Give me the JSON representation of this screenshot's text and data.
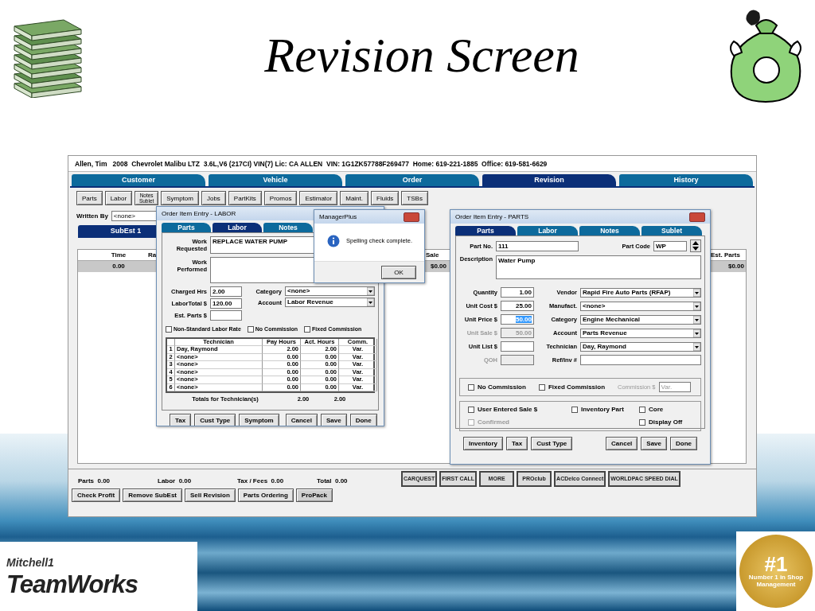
{
  "slide": {
    "title": "Revision Screen",
    "logo": {
      "brand": "Mitchell1",
      "product": "TeamWorks"
    },
    "badge": {
      "mark": "#1",
      "caption": "Number 1 in Shop Management"
    }
  },
  "app": {
    "header": "Allen, Tim   2008  Chevrolet Malibu LTZ  3.6L,V6 (217CI) VIN(7) Lic: CA ALLEN  VIN: 1G1ZK57788F269477  Home: 619-221-1885  Office: 619-581-6629",
    "tabs": [
      {
        "label": "Customer",
        "selected": false
      },
      {
        "label": "Vehicle",
        "selected": false
      },
      {
        "label": "Order",
        "selected": false
      },
      {
        "label": "Revision",
        "selected": true
      },
      {
        "label": "History",
        "selected": false
      }
    ],
    "toolbar": [
      "Parts",
      "Labor",
      "Notes Sublet",
      "Symptom",
      "Jobs",
      "PartKits",
      "Promos",
      "Estimator",
      "Maint.",
      "Fluids",
      "TSBs"
    ],
    "written_by": {
      "label": "Written By",
      "value": "<none>"
    },
    "subest_tabs": [
      {
        "label": "SubEst 1",
        "selected": true
      }
    ],
    "table": {
      "columns": [
        "Time",
        "Ra",
        "Sale",
        "Est. Parts"
      ],
      "rows": [
        {
          "time": "0.00",
          "sale": "$0.00",
          "est_parts": "$0.00"
        }
      ]
    },
    "totals": [
      {
        "label": "Parts",
        "value": "0.00"
      },
      {
        "label": "Labor",
        "value": "0.00"
      },
      {
        "label": "Tax / Fees",
        "value": "0.00"
      },
      {
        "label": "Total",
        "value": "0.00"
      }
    ],
    "vendor_logos": [
      "CARQUEST",
      "FIRST CALL",
      "MORE",
      "PROclub",
      "ACDelco Connect",
      "WORLDPAC SPEED DIAL"
    ],
    "buttons": [
      "Check Profit",
      "Remove SubEst",
      "Sell Revision",
      "Parts Ordering",
      "ProPack"
    ]
  },
  "labor_dialog": {
    "title": "Order Item Entry - LABOR",
    "tabs": [
      {
        "label": "Parts",
        "selected": false
      },
      {
        "label": "Labor",
        "selected": true
      },
      {
        "label": "Notes",
        "selected": false
      }
    ],
    "work_requested": {
      "label": "Work Requested",
      "value": "REPLACE WATER PUMP"
    },
    "work_performed": {
      "label": "Work Performed"
    },
    "left_fields": [
      {
        "label": "Charged Hrs",
        "value": "2.00"
      },
      {
        "label": "LaborTotal $",
        "value": "120.00"
      },
      {
        "label": "Est. Parts $"
      }
    ],
    "right_fields": [
      {
        "label": "Category",
        "value": "<none>"
      },
      {
        "label": "Account",
        "value": "Labor Revenue"
      }
    ],
    "checkboxes": [
      {
        "label": "Non-Standard Labor Rate",
        "checked": false
      },
      {
        "label": "No Commission",
        "checked": false
      },
      {
        "label": "Fixed Commission",
        "checked": false
      }
    ],
    "tech_columns": [
      "Technician",
      "Pay Hours",
      "Act. Hours",
      "Comm."
    ],
    "tech_rows": [
      {
        "num": "1",
        "tech": "Day, Raymond",
        "pay": "2.00",
        "act": "2.00",
        "comm": "Var."
      },
      {
        "num": "2",
        "tech": "<none>",
        "pay": "0.00",
        "act": "0.00",
        "comm": "Var."
      },
      {
        "num": "3",
        "tech": "<none>",
        "pay": "0.00",
        "act": "0.00",
        "comm": "Var."
      },
      {
        "num": "4",
        "tech": "<none>",
        "pay": "0.00",
        "act": "0.00",
        "comm": "Var."
      },
      {
        "num": "5",
        "tech": "<none>",
        "pay": "0.00",
        "act": "0.00",
        "comm": "Var."
      },
      {
        "num": "6",
        "tech": "<none>",
        "pay": "0.00",
        "act": "0.00",
        "comm": "Var."
      }
    ],
    "tech_totals": {
      "label": "Totals for Technician(s)",
      "pay": "2.00",
      "act": "2.00"
    },
    "buttons_left": [
      "Tax",
      "Cust Type",
      "Symptom"
    ],
    "buttons_right": [
      "Cancel",
      "Save",
      "Done"
    ]
  },
  "message_box": {
    "title": "ManagerPlus",
    "message": "Spelling check complete.",
    "button": "OK"
  },
  "parts_dialog": {
    "title": "Order Item Entry - PARTS",
    "tabs": [
      {
        "label": "Parts",
        "selected": true
      },
      {
        "label": "Labor",
        "selected": false
      },
      {
        "label": "Notes",
        "selected": false
      },
      {
        "label": "Sublet",
        "selected": false
      }
    ],
    "part_no": {
      "label": "Part No.",
      "value": "111"
    },
    "part_code": {
      "label": "Part Code",
      "value": "WP"
    },
    "description": {
      "label": "Description",
      "value": "Water Pump"
    },
    "left_fields": [
      {
        "label": "Quantity",
        "value": "1.00",
        "disabled": false,
        "highlighted": false
      },
      {
        "label": "Unit Cost $",
        "value": "25.00",
        "disabled": false,
        "highlighted": false
      },
      {
        "label": "Unit Price $",
        "value": "50.00",
        "disabled": false,
        "highlighted": true
      },
      {
        "label": "Unit Sale $",
        "value": "50.00",
        "disabled": true,
        "highlighted": false
      },
      {
        "label": "Unit List $",
        "disabled": false
      },
      {
        "label": "QOH",
        "disabled": true
      }
    ],
    "right_fields": [
      {
        "label": "Vendor",
        "value": "Rapid Fire Auto Parts (RFAP)",
        "kind": "select"
      },
      {
        "label": "Manufact.",
        "value": "<none>",
        "kind": "select"
      },
      {
        "label": "Category",
        "value": "Engine Mechanical",
        "kind": "select"
      },
      {
        "label": "Account",
        "value": "Parts Revenue",
        "kind": "select"
      },
      {
        "label": "Technician",
        "value": "Day, Raymond",
        "kind": "select"
      },
      {
        "label": "Ref/Inv #",
        "kind": "text"
      }
    ],
    "commission": {
      "checkboxes": [
        {
          "label": "No Commission",
          "checked": false
        },
        {
          "label": "Fixed Commission",
          "checked": false
        }
      ],
      "amount_label": "Commission $",
      "amount_value": "Var.",
      "disabled": true
    },
    "options": [
      {
        "label": "User Entered Sale $",
        "checked": false,
        "disabled": false
      },
      {
        "label": "Inventory Part",
        "checked": false,
        "disabled": false
      },
      {
        "label": "Core",
        "checked": false,
        "disabled": false
      },
      {
        "label": "Confirmed",
        "checked": false,
        "disabled": true
      },
      {
        "label": "Display Off",
        "checked": false,
        "disabled": false
      }
    ],
    "buttons_left": [
      "Inventory",
      "Tax",
      "Cust Type"
    ],
    "buttons_right": [
      "Cancel",
      "Save",
      "Done"
    ]
  }
}
